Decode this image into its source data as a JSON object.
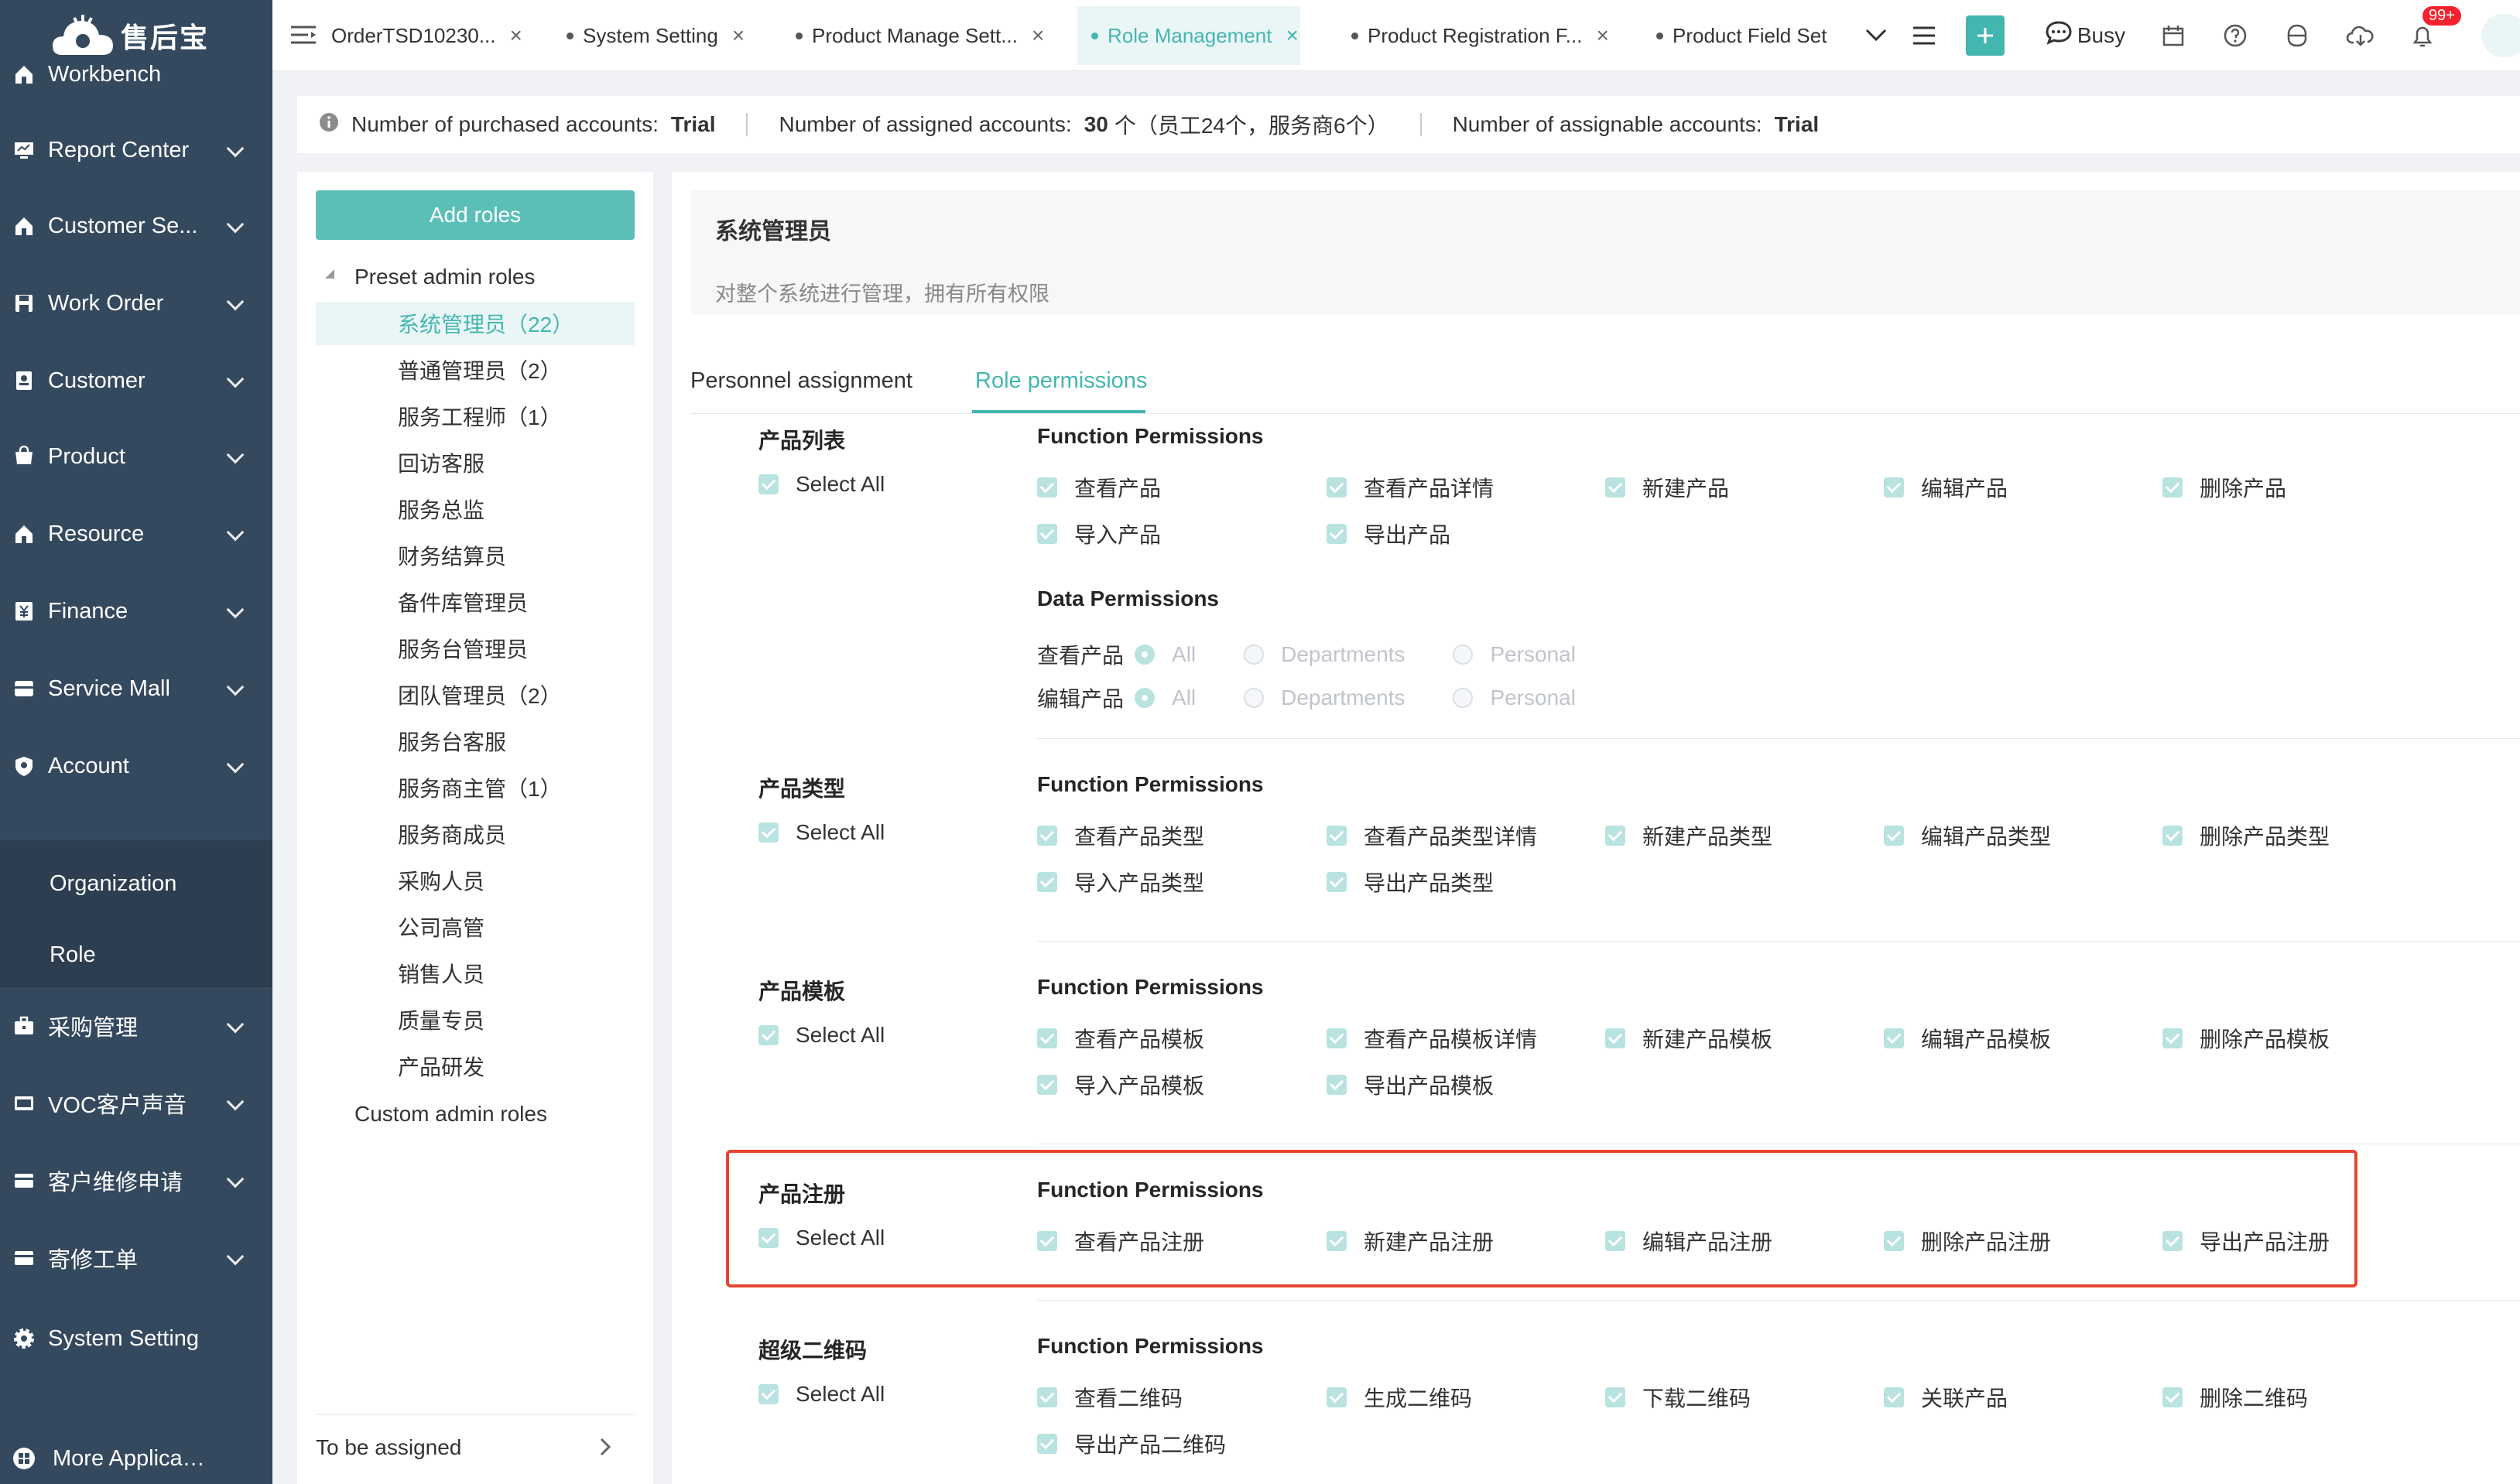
{
  "app": {
    "logo_text": "售后宝"
  },
  "sidebar": {
    "items": [
      {
        "label": "Workbench",
        "icon": "home-icon"
      },
      {
        "label": "Report Center",
        "icon": "monitor-icon"
      },
      {
        "label": "Customer Se...",
        "icon": "home-icon"
      },
      {
        "label": "Work Order",
        "icon": "save-icon"
      },
      {
        "label": "Customer",
        "icon": "contact-card-icon"
      },
      {
        "label": "Product",
        "icon": "cart-icon"
      },
      {
        "label": "Resource",
        "icon": "home-icon"
      },
      {
        "label": "Finance",
        "icon": "yen-icon"
      },
      {
        "label": "Service Mall",
        "icon": "store-icon"
      },
      {
        "label": "Account",
        "icon": "shield-icon"
      }
    ],
    "sub_items": [
      "Organization",
      "Role"
    ],
    "items2": [
      {
        "label": "采购管理",
        "icon": "briefcase-icon"
      },
      {
        "label": "VOC客户声音",
        "icon": "screen-icon"
      },
      {
        "label": "客户维修申请",
        "icon": "card-icon"
      },
      {
        "label": "寄修工单",
        "icon": "card-icon"
      },
      {
        "label": "System Setting",
        "icon": "gear-icon"
      }
    ],
    "more": "More Applications"
  },
  "tabs": [
    {
      "label": "OrderTSD10230..."
    },
    {
      "label": "System Setting"
    },
    {
      "label": "Product Manage Sett..."
    },
    {
      "label": "Role Management"
    },
    {
      "label": "Product Registration F..."
    },
    {
      "label": "Product Field Set"
    }
  ],
  "toolbar": {
    "status": "Busy",
    "badge": "99+"
  },
  "infobar": {
    "purchased_label": "Number of purchased accounts:",
    "purchased_value": "Trial",
    "assigned_label": "Number of assigned accounts:",
    "assigned_value": "30",
    "assigned_detail": "个（员工24个，服务商6个）",
    "assignable_label": "Number of assignable accounts:",
    "assignable_value": "Trial"
  },
  "role_panel": {
    "add_button": "Add roles",
    "preset_group": "Preset admin roles",
    "roles": [
      "系统管理员（22）",
      "普通管理员（2）",
      "服务工程师（1）",
      "回访客服",
      "服务总监",
      "财务结算员",
      "备件库管理员",
      "服务台管理员",
      "团队管理员（2）",
      "服务台客服",
      "服务商主管（1）",
      "服务商成员",
      "采购人员",
      "公司高管",
      "销售人员",
      "质量专员",
      "产品研发"
    ],
    "custom_group": "Custom admin roles",
    "to_be_assigned": "To be assigned"
  },
  "role_header": {
    "title": "系统管理员",
    "desc": "对整个系统进行管理，拥有所有权限"
  },
  "main_tabs": [
    "Personnel assignment",
    "Role permissions"
  ],
  "labels": {
    "select_all": "Select All",
    "function_permissions": "Function Permissions",
    "data_permissions": "Data Permissions",
    "all": "All",
    "departments": "Departments",
    "personal": "Personal"
  },
  "sections": [
    {
      "title": "产品列表",
      "perms": [
        "查看产品",
        "查看产品详情",
        "新建产品",
        "编辑产品",
        "删除产品",
        "导入产品",
        "导出产品"
      ],
      "data_perms": [
        {
          "label": "查看产品"
        },
        {
          "label": "编辑产品"
        }
      ]
    },
    {
      "title": "产品类型",
      "perms": [
        "查看产品类型",
        "查看产品类型详情",
        "新建产品类型",
        "编辑产品类型",
        "删除产品类型",
        "导入产品类型",
        "导出产品类型"
      ]
    },
    {
      "title": "产品模板",
      "perms": [
        "查看产品模板",
        "查看产品模板详情",
        "新建产品模板",
        "编辑产品模板",
        "删除产品模板",
        "导入产品模板",
        "导出产品模板"
      ]
    },
    {
      "title": "产品注册",
      "perms": [
        "查看产品注册",
        "新建产品注册",
        "编辑产品注册",
        "删除产品注册",
        "导出产品注册"
      ]
    },
    {
      "title": "超级二维码",
      "perms": [
        "查看二维码",
        "生成二维码",
        "下载二维码",
        "关联产品",
        "删除二维码",
        "导出产品二维码"
      ]
    }
  ],
  "colors": {
    "sidebar": "#34495e",
    "accent": "#44b6b0",
    "highlight": "#e6442f"
  }
}
